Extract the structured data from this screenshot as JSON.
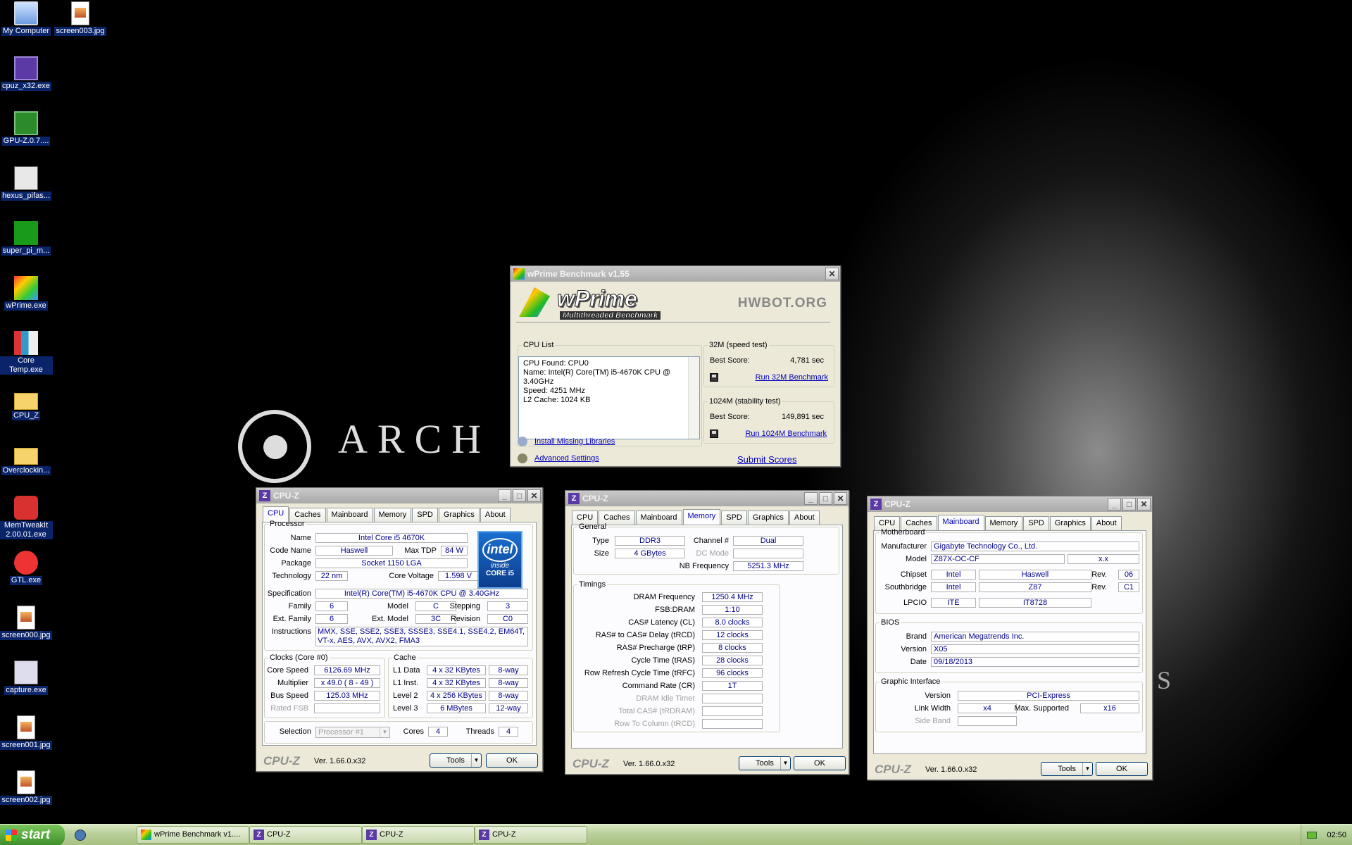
{
  "desktop": {
    "icons": [
      {
        "label": "My Computer",
        "icon": "my-computer-icon"
      },
      {
        "label": "screen003.jpg",
        "icon": "image-file-icon"
      },
      {
        "label": "cpuz_x32.exe",
        "icon": "cpuz-icon"
      },
      {
        "label": "GPU-Z.0.7....",
        "icon": "gpuz-icon"
      },
      {
        "label": "hexus_pifas...",
        "icon": "hexus-icon"
      },
      {
        "label": "super_pi_m...",
        "icon": "superpi-icon"
      },
      {
        "label": "wPrime.exe",
        "icon": "wprime-icon"
      },
      {
        "label": "Core Temp.exe",
        "icon": "coretemp-icon"
      },
      {
        "label": "CPU_Z",
        "icon": "folder-icon"
      },
      {
        "label": "Overclockin...",
        "icon": "folder-icon"
      },
      {
        "label": "MemTweakIt 2.00.01.exe",
        "icon": "memtweakit-icon"
      },
      {
        "label": "GTL.exe",
        "icon": "gtl-icon"
      },
      {
        "label": "screen000.jpg",
        "icon": "image-file-icon"
      },
      {
        "label": "capture.exe",
        "icon": "capture-icon"
      },
      {
        "label": "screen001.jpg",
        "icon": "image-file-icon"
      },
      {
        "label": "screen002.jpg",
        "icon": "image-file-icon"
      }
    ],
    "wallpaper_text": "ARCH E",
    "wallpaper_text2": "S"
  },
  "wprime": {
    "title": "wPrime Benchmark v1.55",
    "logo_text": "wPrime",
    "logo_sub": "Multithreaded Benchmark",
    "hwbot": "HWBOT.ORG",
    "cpu_list_legend": "CPU List",
    "cpu_found": "CPU Found: CPU0",
    "name_line": "Name:    Intel(R) Core(TM) i5-4670K CPU @ 3.40GHz",
    "speed_line": "Speed:    4251 MHz",
    "l2_line": "L2 Cache: 1024 KB",
    "t32_legend": "32M (speed test)",
    "t32_best_label": "Best Score:",
    "t32_best": "4,781 sec",
    "t32_run": "Run 32M Benchmark",
    "t1024_legend": "1024M (stability test)",
    "t1024_best_label": "Best Score:",
    "t1024_best": "149,891 sec",
    "t1024_run": "Run 1024M Benchmark",
    "install": "Install Missing Libraries",
    "advanced": "Advanced Settings",
    "submit": "Submit Scores"
  },
  "cpuz_common": {
    "title": "CPU-Z",
    "tabs": [
      "CPU",
      "Caches",
      "Mainboard",
      "Memory",
      "SPD",
      "Graphics",
      "About"
    ],
    "brand": "CPU-Z",
    "version": "Ver. 1.66.0.x32",
    "tools": "Tools",
    "ok": "OK"
  },
  "cpu": {
    "processor_legend": "Processor",
    "name_label": "Name",
    "name": "Intel Core i5 4670K",
    "codename_label": "Code Name",
    "codename": "Haswell",
    "tdp_label": "Max TDP",
    "tdp": "84 W",
    "package_label": "Package",
    "package": "Socket 1150 LGA",
    "tech_label": "Technology",
    "tech": "22 nm",
    "voltage_label": "Core Voltage",
    "voltage": "1.598 V",
    "spec_label": "Specification",
    "spec": "Intel(R) Core(TM) i5-4670K CPU @ 3.40GHz",
    "family_label": "Family",
    "family": "6",
    "model_label": "Model",
    "model": "C",
    "stepping_label": "Stepping",
    "stepping": "3",
    "extfamily_label": "Ext. Family",
    "extfamily": "6",
    "extmodel_label": "Ext. Model",
    "extmodel": "3C",
    "revision_label": "Revision",
    "revision": "C0",
    "instr_label": "Instructions",
    "instr": "MMX, SSE, SSE2, SSE3, SSSE3, SSE4.1, SSE4.2, EM64T, VT-x, AES, AVX, AVX2, FMA3",
    "intel_logo": "intel",
    "intel_inside": "inside",
    "intel_core": "CORE i5",
    "clocks_legend": "Clocks (Core #0)",
    "corespeed_label": "Core Speed",
    "corespeed": "6126.69 MHz",
    "multiplier_label": "Multiplier",
    "multiplier": "x 49.0 ( 8 - 49 )",
    "busspeed_label": "Bus Speed",
    "busspeed": "125.03 MHz",
    "ratedfsb_label": "Rated FSB",
    "ratedfsb": "",
    "cache_legend": "Cache",
    "l1d_label": "L1 Data",
    "l1d": "4 x 32 KBytes",
    "l1d_way": "8-way",
    "l1i_label": "L1 Inst.",
    "l1i": "4 x 32 KBytes",
    "l1i_way": "8-way",
    "l2_label": "Level 2",
    "l2": "4 x 256 KBytes",
    "l2_way": "8-way",
    "l3_label": "Level 3",
    "l3": "6 MBytes",
    "l3_way": "12-way",
    "selection_label": "Selection",
    "selection": "Processor #1",
    "cores_label": "Cores",
    "cores": "4",
    "threads_label": "Threads",
    "threads": "4"
  },
  "memory": {
    "general_legend": "General",
    "type_label": "Type",
    "type": "DDR3",
    "channel_label": "Channel #",
    "channel": "Dual",
    "size_label": "Size",
    "size": "4 GBytes",
    "dcmode_label": "DC Mode",
    "dcmode": "",
    "nbfreq_label": "NB Frequency",
    "nbfreq": "5251.3 MHz",
    "timings_legend": "Timings",
    "rows": [
      {
        "label": "DRAM Frequency",
        "value": "1250.4 MHz",
        "dim": false
      },
      {
        "label": "FSB:DRAM",
        "value": "1:10",
        "dim": false
      },
      {
        "label": "CAS# Latency (CL)",
        "value": "8.0 clocks",
        "dim": false
      },
      {
        "label": "RAS# to CAS# Delay (tRCD)",
        "value": "12 clocks",
        "dim": false
      },
      {
        "label": "RAS# Precharge (tRP)",
        "value": "8 clocks",
        "dim": false
      },
      {
        "label": "Cycle Time (tRAS)",
        "value": "28 clocks",
        "dim": false
      },
      {
        "label": "Row Refresh Cycle Time (tRFC)",
        "value": "96 clocks",
        "dim": false
      },
      {
        "label": "Command Rate (CR)",
        "value": "1T",
        "dim": false
      },
      {
        "label": "DRAM Idle Timer",
        "value": "",
        "dim": true
      },
      {
        "label": "Total CAS# (tRDRAM)",
        "value": "",
        "dim": true
      },
      {
        "label": "Row To Column (tRCD)",
        "value": "",
        "dim": true
      }
    ]
  },
  "mainboard": {
    "mb_legend": "Motherboard",
    "manufacturer_label": "Manufacturer",
    "manufacturer": "Gigabyte Technology Co., Ltd.",
    "model_label": "Model",
    "model": "Z87X-OC-CF",
    "model_rev": "x.x",
    "chipset_label": "Chipset",
    "chipset_vendor": "Intel",
    "chipset": "Haswell",
    "chipset_rev_label": "Rev.",
    "chipset_rev": "06",
    "south_label": "Southbridge",
    "south_vendor": "Intel",
    "south": "Z87",
    "south_rev_label": "Rev.",
    "south_rev": "C1",
    "lpcio_label": "LPCIO",
    "lpcio_vendor": "ITE",
    "lpcio": "IT8728",
    "bios_legend": "BIOS",
    "brand_label": "Brand",
    "brand": "American Megatrends Inc.",
    "version_label": "Version",
    "version": "X05",
    "date_label": "Date",
    "date": "09/18/2013",
    "gi_legend": "Graphic Interface",
    "gi_version_label": "Version",
    "gi_version": "PCI-Express",
    "link_label": "Link Width",
    "link": "x4",
    "max_label": "Max. Supported",
    "max": "x16",
    "side_label": "Side Band",
    "side": ""
  },
  "taskbar": {
    "start": "start",
    "tasks": [
      "wPrime Benchmark v1....",
      "CPU-Z",
      "CPU-Z",
      "CPU-Z"
    ],
    "clock": "02:50"
  }
}
